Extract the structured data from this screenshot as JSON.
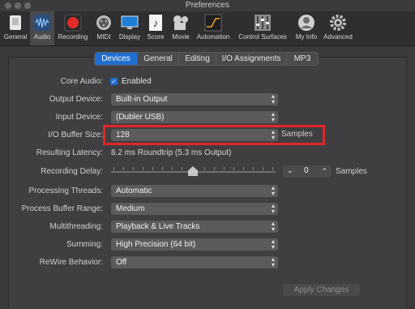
{
  "window": {
    "title": "Preferences"
  },
  "toolbar": {
    "items": [
      {
        "label": "General",
        "icon": "switch-icon"
      },
      {
        "label": "Audio",
        "icon": "waveform-icon"
      },
      {
        "label": "Recording",
        "icon": "record-icon"
      },
      {
        "label": "MIDI",
        "icon": "midi-icon"
      },
      {
        "label": "Display",
        "icon": "display-icon"
      },
      {
        "label": "Score",
        "icon": "score-icon"
      },
      {
        "label": "Movie",
        "icon": "movie-icon"
      },
      {
        "label": "Automation",
        "icon": "automation-icon"
      },
      {
        "label": "Control Surfaces",
        "icon": "control-surfaces-icon"
      },
      {
        "label": "My Info",
        "icon": "user-icon"
      },
      {
        "label": "Advanced",
        "icon": "gear-icon"
      }
    ],
    "selected": "Audio"
  },
  "tabs": {
    "items": [
      "Devices",
      "General",
      "Editing",
      "I/O Assignments",
      "MP3"
    ],
    "active": "Devices"
  },
  "form": {
    "core_audio": {
      "label": "Core Audio:",
      "checkbox_label": "Enabled",
      "checked": true
    },
    "output_device": {
      "label": "Output Device:",
      "value": "Built-in Output"
    },
    "input_device": {
      "label": "Input Device:",
      "value": "(Dubler USB)"
    },
    "io_buffer_size": {
      "label": "I/O Buffer Size:",
      "value": "128",
      "unit": "Samples"
    },
    "resulting_latency": {
      "label": "Resulting Latency:",
      "value": "8.2 ms Roundtrip (5.3 ms Output)"
    },
    "recording_delay": {
      "label": "Recording Delay:",
      "value": "0",
      "unit": "Samples"
    },
    "processing_threads": {
      "label": "Processing Threads:",
      "value": "Automatic"
    },
    "process_buffer_range": {
      "label": "Process Buffer Range:",
      "value": "Medium"
    },
    "multithreading": {
      "label": "Multithreading:",
      "value": "Playback & Live Tracks"
    },
    "summing": {
      "label": "Summing:",
      "value": "High Precision (64 bit)"
    },
    "rewire_behavior": {
      "label": "ReWire Behavior:",
      "value": "Off"
    }
  },
  "buttons": {
    "apply_label": "Apply Changes"
  },
  "colors": {
    "accent": "#1e6fd1",
    "highlight": "#e0262a",
    "record": "#e22b2b"
  }
}
